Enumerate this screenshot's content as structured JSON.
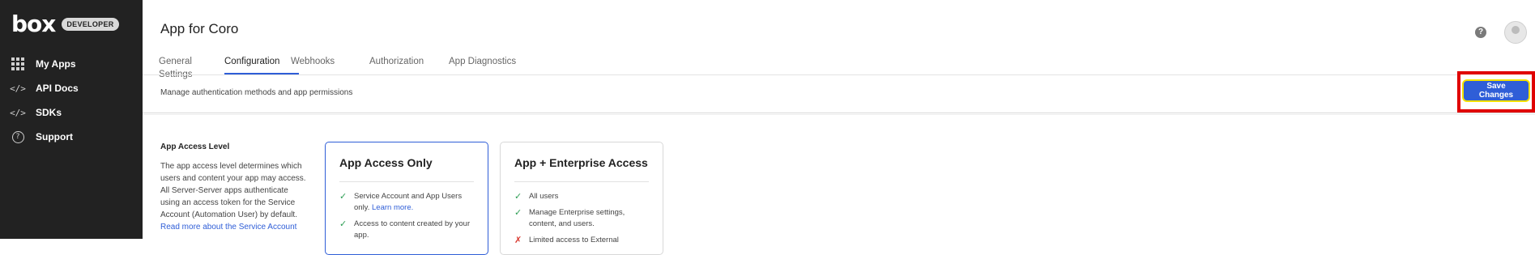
{
  "sidebar": {
    "logo": "box",
    "badge": "DEVELOPER",
    "items": [
      {
        "label": "My Apps",
        "icon": "grid-icon"
      },
      {
        "label": "API Docs",
        "icon": "code-icon"
      },
      {
        "label": "SDKs",
        "icon": "code-icon"
      },
      {
        "label": "Support",
        "icon": "question-circle-icon"
      }
    ]
  },
  "header": {
    "title": "App for Coro",
    "help_icon": "question-icon",
    "avatar_icon": "user-avatar-icon"
  },
  "tabs": [
    {
      "label": "General Settings",
      "active": false
    },
    {
      "label": "Configuration",
      "active": true
    },
    {
      "label": "Webhooks",
      "active": false
    },
    {
      "label": "Authorization",
      "active": false
    },
    {
      "label": "App Diagnostics",
      "active": false
    }
  ],
  "subbar": {
    "description": "Manage authentication methods and app permissions",
    "save_label": "Save Changes"
  },
  "access_level": {
    "heading": "App Access Level",
    "description_text": "The app access level determines which users and content your app may access. All Server-Server apps authenticate using an access token for the Service Account (Automation User) by default.",
    "description_link": "Read more about the Service Account"
  },
  "cards": [
    {
      "title": "App Access Only",
      "selected": true,
      "items": [
        {
          "type": "check",
          "text": "Service Account and App Users only.",
          "link": "Learn more."
        },
        {
          "type": "check",
          "text": "Access to content created by your app.",
          "link": ""
        }
      ]
    },
    {
      "title": "App + Enterprise Access",
      "selected": false,
      "items": [
        {
          "type": "check",
          "text": "All users",
          "link": ""
        },
        {
          "type": "check",
          "text": "Manage Enterprise settings, content, and users.",
          "link": ""
        },
        {
          "type": "cross",
          "text": "Limited access to External",
          "link": ""
        }
      ]
    }
  ],
  "colors": {
    "accent": "#2f5ed7",
    "sidebar_bg": "#222222",
    "highlight": "#e00000"
  }
}
